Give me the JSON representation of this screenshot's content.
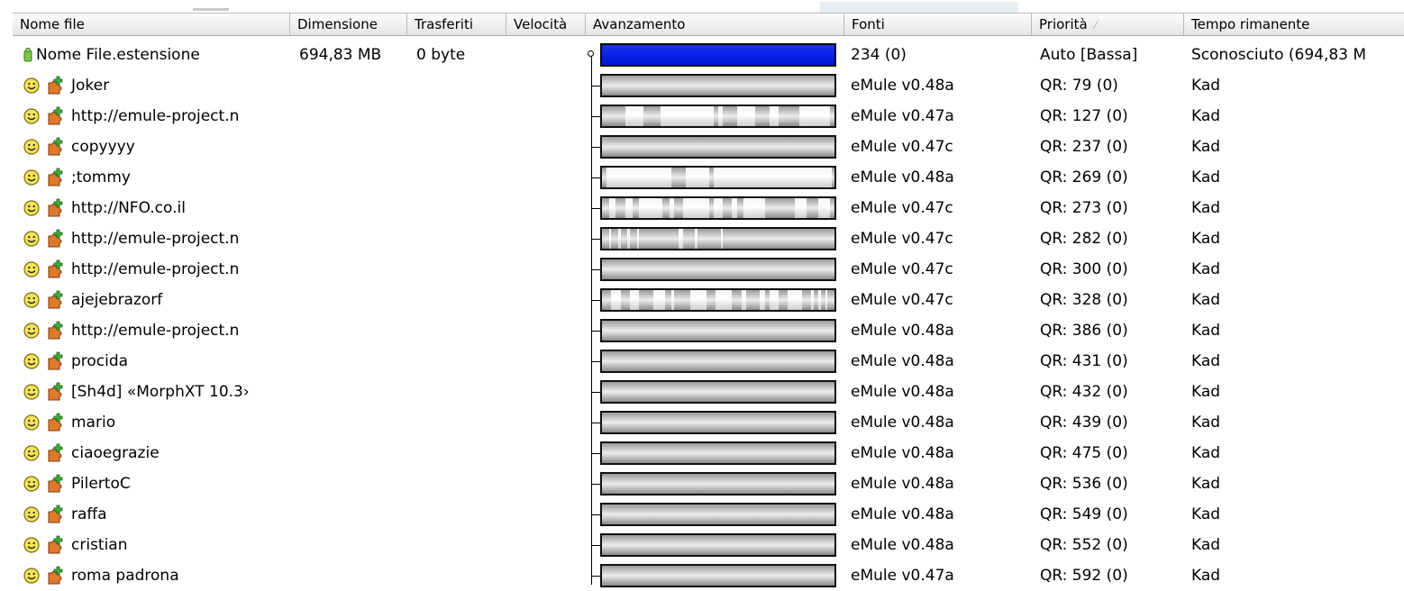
{
  "columns": {
    "nome_file": "Nome file",
    "dimensione": "Dimensione",
    "trasferiti": "Trasferiti",
    "velocita": "Velocità",
    "avanzamento": "Avanzamento",
    "fonti": "Fonti",
    "priorita": "Priorità",
    "tempo_rimanente": "Tempo rimanente"
  },
  "sort_indicator": "⁄",
  "file": {
    "name": "Nome File.estensione",
    "size": "694,83 MB",
    "transferred": "0 byte",
    "sources": "234 (0)",
    "priority": "Auto [Bassa]",
    "remaining": "Sconosciuto (694,83 M"
  },
  "sources": [
    {
      "name": "Joker",
      "client": "eMule v0.48a",
      "qr": "QR: 79 (0)",
      "time": "Kad",
      "icon": "smiley-icon"
    },
    {
      "name": "http://emule-project.n",
      "client": "eMule v0.47a",
      "qr": "QR: 127 (0)",
      "time": "Kad",
      "icon": "smiley-icon"
    },
    {
      "name": "copyyyy",
      "client": "eMule v0.47c",
      "qr": "QR: 237 (0)",
      "time": "Kad",
      "icon": "smiley-icon"
    },
    {
      "name": ";tommy",
      "client": "eMule v0.48a",
      "qr": "QR: 269 (0)",
      "time": "Kad",
      "icon": "smiley-icon"
    },
    {
      "name": "http://NFO.co.il",
      "client": "eMule v0.47c",
      "qr": "QR: 273 (0)",
      "time": "Kad",
      "icon": "smiley-icon"
    },
    {
      "name": "http://emule-project.n",
      "client": "eMule v0.47c",
      "qr": "QR: 282 (0)",
      "time": "Kad",
      "icon": "smiley-icon"
    },
    {
      "name": "http://emule-project.n",
      "client": "eMule v0.47c",
      "qr": "QR: 300 (0)",
      "time": "Kad",
      "icon": "smiley-icon"
    },
    {
      "name": "ajejebrazorf",
      "client": "eMule v0.47c",
      "qr": "QR: 328 (0)",
      "time": "Kad",
      "icon": "smiley-icon"
    },
    {
      "name": "http://emule-project.n",
      "client": "eMule v0.48a",
      "qr": "QR: 386 (0)",
      "time": "Kad",
      "icon": "smiley-icon"
    },
    {
      "name": "procida",
      "client": "eMule v0.48a",
      "qr": "QR: 431 (0)",
      "time": "Kad",
      "icon": "smiley-icon"
    },
    {
      "name": "[Sh4d] «MorphXT 10.3›",
      "client": "eMule v0.48a",
      "qr": "QR: 432 (0)",
      "time": "Kad",
      "icon": "smiley-icon"
    },
    {
      "name": "mario",
      "client": "eMule v0.48a",
      "qr": "QR: 439 (0)",
      "time": "Kad",
      "icon": "smiley-icon"
    },
    {
      "name": "ciaoegrazie",
      "client": "eMule v0.48a",
      "qr": "QR: 475 (0)",
      "time": "Kad",
      "icon": "smiley-icon"
    },
    {
      "name": "PilertoC",
      "client": "eMule v0.48a",
      "qr": "QR: 536 (0)",
      "time": "Kad",
      "icon": "smiley-icon"
    },
    {
      "name": "raffa",
      "client": "eMule v0.48a",
      "qr": "QR: 549 (0)",
      "time": "Kad",
      "icon": "smiley-icon"
    },
    {
      "name": "cristian",
      "client": "eMule v0.48a",
      "qr": "QR: 552 (0)",
      "time": "Kad",
      "icon": "smiley-icon"
    },
    {
      "name": "roma padrona",
      "client": "eMule v0.47a",
      "qr": "QR: 592 (0)",
      "time": "Kad",
      "icon": "smiley-icon"
    }
  ],
  "colors": {
    "progress_blue": "#0b24f0",
    "chunk_available": "#ffffff",
    "chunk_missing": "#808080"
  }
}
